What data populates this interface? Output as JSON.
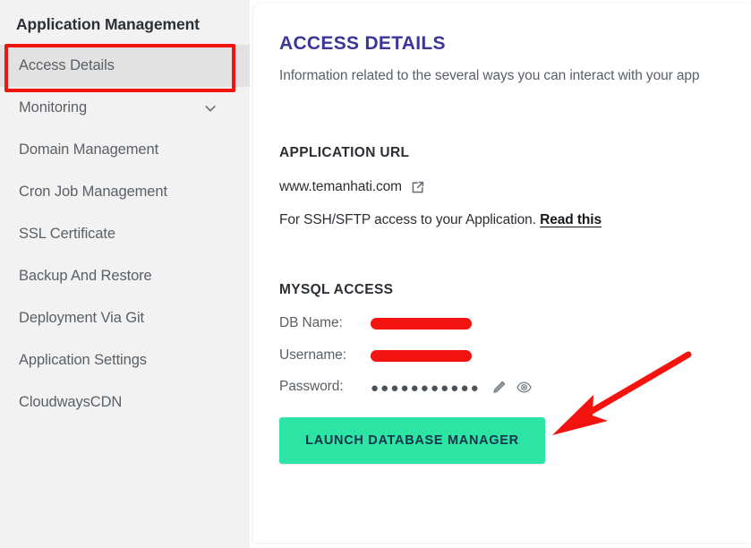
{
  "sidebar": {
    "title": "Application Management",
    "items": [
      {
        "label": "Access Details",
        "active": true,
        "icon": ""
      },
      {
        "label": "Monitoring",
        "active": false,
        "icon": "chevron-down-icon"
      },
      {
        "label": "Domain Management",
        "active": false,
        "icon": ""
      },
      {
        "label": "Cron Job Management",
        "active": false,
        "icon": ""
      },
      {
        "label": "SSL Certificate",
        "active": false,
        "icon": ""
      },
      {
        "label": "Backup And Restore",
        "active": false,
        "icon": ""
      },
      {
        "label": "Deployment Via Git",
        "active": false,
        "icon": ""
      },
      {
        "label": "Application Settings",
        "active": false,
        "icon": ""
      },
      {
        "label": "CloudwaysCDN",
        "active": false,
        "icon": ""
      }
    ]
  },
  "main": {
    "title": "ACCESS DETAILS",
    "subtitle": "Information related to the several ways you can interact with your app",
    "application_url": {
      "section_title": "APPLICATION URL",
      "url": "www.temanhati.com",
      "external_link_icon": "external-link-icon",
      "ssh_text_before": "For SSH/SFTP access to your Application.",
      "ssh_link_label": "Read this"
    },
    "mysql_access": {
      "section_title": "MYSQL ACCESS",
      "db_name_label": "DB Name:",
      "db_name_value": "",
      "username_label": "Username:",
      "username_value": "",
      "password_label": "Password:",
      "password_masked": "●●●●●●●●●●●",
      "edit_icon": "pencil-icon",
      "reveal_icon": "eye-icon",
      "launch_button_label": "LAUNCH DATABASE MANAGER"
    }
  },
  "annotations": {
    "highlight_color": "#f4140f",
    "arrow_color": "#f4140f",
    "accent_button_color": "#2ce5a5",
    "title_color": "#3b3697"
  }
}
